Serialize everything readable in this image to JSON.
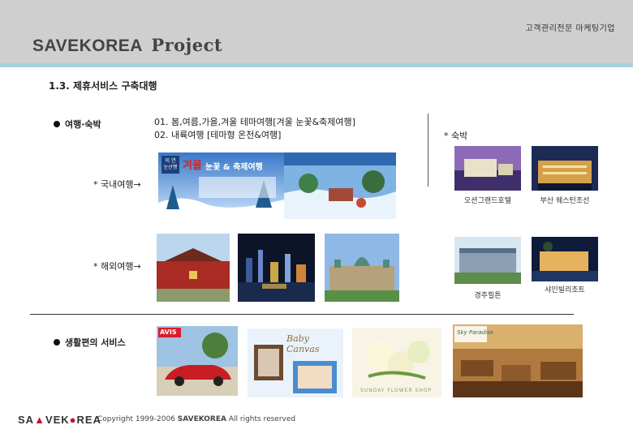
{
  "header": {
    "tagline": "고객관리전문 마케팅기업",
    "title_main": "SAVEKOREA",
    "title_sub": "Project"
  },
  "section_title": "1.3. 제휴서비스 구축대행",
  "travel": {
    "label": "여행·숙박",
    "line1": "01. 봄,여름,가을,겨울 테마여행[겨울 눈꽃&축제여행]",
    "line2": "02. 내륙여행 [테마형 온천&여행]",
    "domestic_label": "* 국내여행→",
    "overseas_label": "* 해외여행→",
    "banner1_title": "눈꽃 & 축제여행",
    "banner1_season": "겨울",
    "banner1_badge": "미 연 눈산행"
  },
  "lodging": {
    "label": "* 숙박",
    "captions": [
      "오션그랜드호텔",
      "부산 웨스턴조선",
      "경주힐튼",
      "샤인빌리조트"
    ]
  },
  "living": {
    "label": "생활편의 서비스",
    "avis": "AVIS",
    "baby": "Baby Canvas",
    "flower": "SUNDAY FLOWER SHOP",
    "sky": "Sky Paradise"
  },
  "footer": {
    "logo_a": "SA",
    "logo_b": "VE",
    "logo_c": "K",
    "logo_d": "REA",
    "copyright_pre": "Copyright 1999-2006 ",
    "copyright_brand": "SAVEKOREA",
    "copyright_post": " All rights reserved"
  },
  "colors": {
    "header_bg": "#cfcfcf",
    "header_accent": "#a7d3e0",
    "logo_accent": "#c8102e"
  }
}
